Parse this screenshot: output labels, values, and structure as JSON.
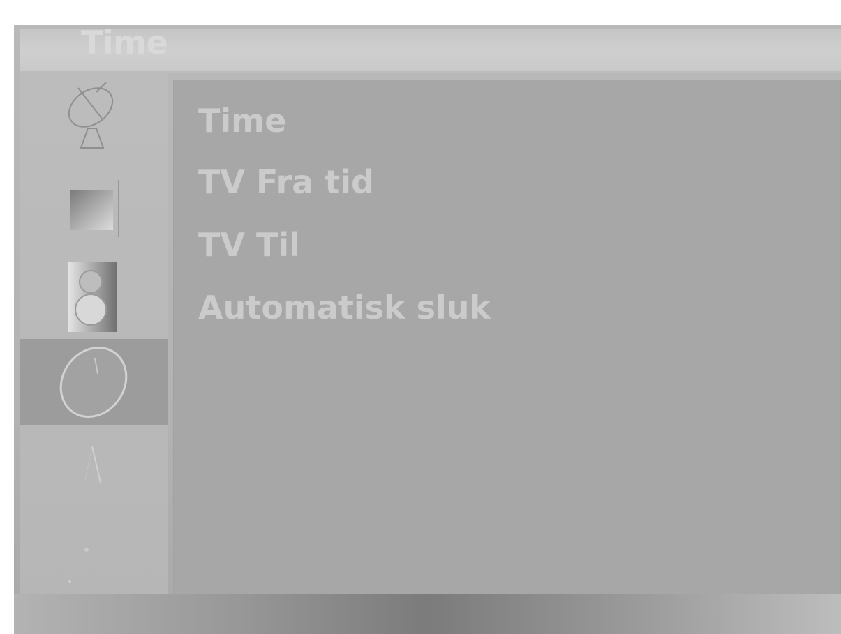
{
  "window": {
    "title": "Time"
  },
  "sidebar": {
    "items": [
      {
        "icon": "satellite-dish-icon",
        "selected": false
      },
      {
        "icon": "picture-icon",
        "selected": false
      },
      {
        "icon": "speaker-icon",
        "selected": false
      },
      {
        "icon": "clock-icon",
        "selected": true
      },
      {
        "icon": "lock-icon",
        "selected": false
      },
      {
        "icon": "options-icon",
        "selected": false
      }
    ]
  },
  "menu": {
    "items": [
      {
        "label": "Time"
      },
      {
        "label": "TV Fra tid"
      },
      {
        "label": "TV Til"
      },
      {
        "label": "Automatisk sluk"
      }
    ]
  },
  "colors": {
    "background": "#b5b5b5",
    "content_panel": "#a7a7a7",
    "selected_item": "#9c9c9c",
    "text": "#cbcbcb"
  }
}
